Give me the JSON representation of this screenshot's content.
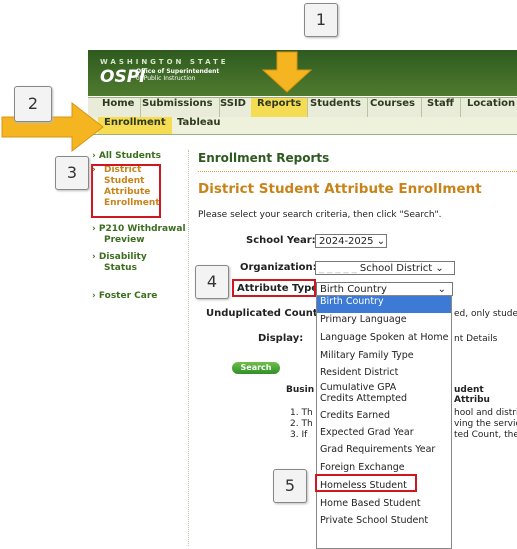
{
  "header": {
    "state_text": "WASHINGTON STATE",
    "logo": "OSPI",
    "logo_sub1": "Office of Superintendent",
    "logo_sub2": "of Public Instruction"
  },
  "nav": {
    "items": [
      "Home",
      "Submissions",
      "SSID",
      "Reports",
      "Students",
      "Courses",
      "Staff",
      "Location",
      "S"
    ],
    "active": "Reports"
  },
  "subnav": {
    "items": [
      "Enrollment",
      "Tableau"
    ],
    "active": "Enrollment"
  },
  "sidebar": {
    "items": [
      {
        "label": "All Students"
      },
      {
        "label": "District Student Attribute Enrollment"
      },
      {
        "label": "P210 Withdrawal Preview"
      },
      {
        "label": "Disability Status"
      },
      {
        "label": "Foster Care"
      }
    ],
    "lines": {
      "district": [
        "District",
        "Student",
        "Attribute",
        "Enrollment"
      ],
      "p210": [
        "P210 Withdrawal",
        "Preview"
      ],
      "disability": [
        "Disability",
        "Status"
      ]
    }
  },
  "main": {
    "section_title": "Enrollment Reports",
    "page_title": "District Student Attribute Enrollment",
    "instructions": "Please select your search criteria, then click \"Search\".",
    "school_year_label": "School Year:",
    "school_year_value": "2024-2025",
    "organization_label": "Organization:",
    "organization_value": "School District",
    "attribute_type_label": "Attribute Type:",
    "attribute_type_value": "Birth Country",
    "unduplicated_label": "Unduplicated Count:",
    "unduplicated_partial": "ed, only stude",
    "display_label": "Display:",
    "display_partial": "nt Details",
    "search_button": "Search",
    "business_partial": "Busin",
    "student_attrib_partial": "udent Attribu",
    "rules": [
      "1. Th",
      "2. Th",
      "3. If"
    ],
    "rules_right": [
      "hool and distri",
      "ving the servic",
      "ted Count, the"
    ]
  },
  "dropdown": {
    "options": [
      "Birth Country",
      "Primary Language",
      "Language Spoken at Home",
      "Military Family Type",
      "Resident District",
      "Cumulative GPA",
      "Credits Attempted",
      "Credits Earned",
      "Expected Grad Year",
      "Grad Requirements Year",
      "Foreign Exchange",
      "Homeless Student",
      "Home Based Student",
      "Private School Student"
    ],
    "highlighted": "Birth Country"
  },
  "callouts": [
    "1",
    "2",
    "3",
    "4",
    "5"
  ],
  "colors": {
    "accent_yellow": "#f6dc53",
    "callout_red": "#d0161e",
    "arrow_orange": "#f5b521",
    "title_orange": "#c8841a",
    "nav_green": "#2e5a1f"
  }
}
